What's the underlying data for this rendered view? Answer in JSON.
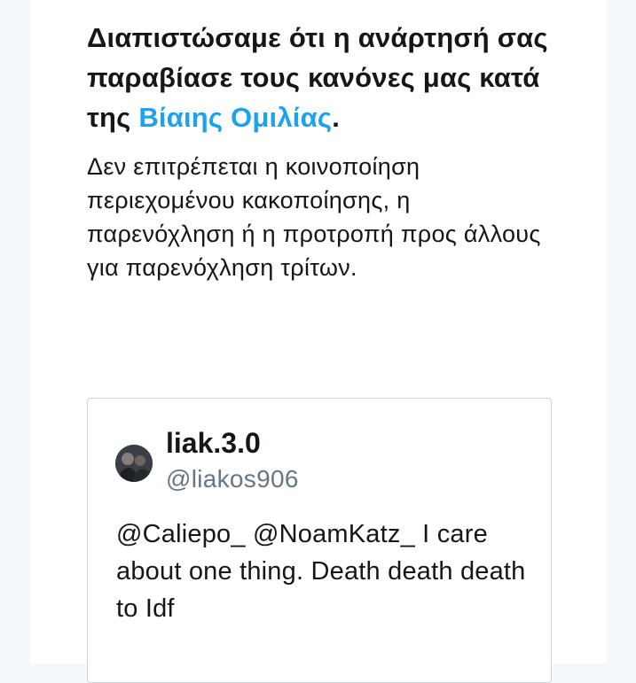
{
  "notice": {
    "headline_before_link": "Διαπιστώσαμε ότι η ανάρτησή σας παραβίασε τους κανόνες μας κατά της ",
    "policy_link": "Βίαιης Ομιλίας",
    "headline_after_link": ".",
    "description": "Δεν επιτρέπεται η κοινοποίηση περιεχομένου κακοποίησης, η παρενόχληση ή η προτροπή προς άλλους για παρενόχληση τρίτων."
  },
  "tweet": {
    "display_name": "liak.3.0",
    "handle": "@liakos906",
    "text": "@Caliepo_ @NoamKatz_ I care about one thing. Death death death to Idf"
  },
  "colors": {
    "link": "#1da1f2",
    "text": "#14171a",
    "secondary_text": "#657786",
    "border": "#ccd6dd",
    "page_background": "#f5f8fa"
  }
}
